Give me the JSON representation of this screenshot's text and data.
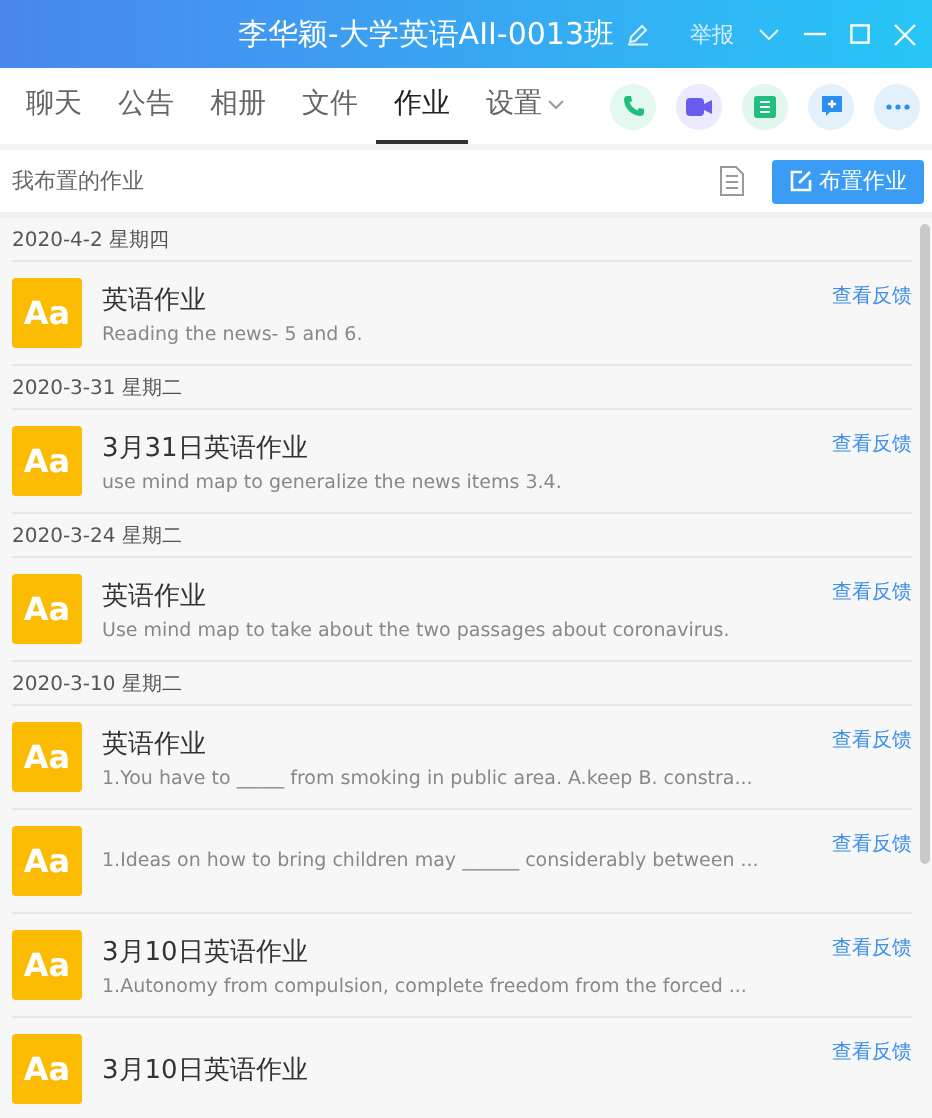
{
  "window": {
    "title": "李华颖-大学英语AII-0013班",
    "report": "举报"
  },
  "tabs": [
    {
      "label": "聊天",
      "selected": false,
      "kind": "plain"
    },
    {
      "label": "公告",
      "selected": false,
      "kind": "plain"
    },
    {
      "label": "相册",
      "selected": false,
      "kind": "plain"
    },
    {
      "label": "文件",
      "selected": false,
      "kind": "plain"
    },
    {
      "label": "作业",
      "selected": true,
      "kind": "plain"
    },
    {
      "label": "设置",
      "selected": false,
      "kind": "dropdown"
    }
  ],
  "toolbar": {
    "heading": "我布置的作业",
    "button": "布置作业"
  },
  "groups": [
    {
      "date": "2020-4-2 星期四",
      "items": [
        {
          "icon": "Aa",
          "title": "英语作业",
          "description": "Reading the news- 5 and 6.",
          "link": "查看反馈"
        }
      ]
    },
    {
      "date": "2020-3-31 星期二",
      "items": [
        {
          "icon": "Aa",
          "title": "3月31日英语作业",
          "description": "use mind map to generalize the news items 3.4.",
          "link": "查看反馈"
        }
      ]
    },
    {
      "date": "2020-3-24 星期二",
      "items": [
        {
          "icon": "Aa",
          "title": "英语作业",
          "description": "Use mind map to take about the two passages about coronavirus.",
          "link": "查看反馈"
        }
      ]
    },
    {
      "date": "2020-3-10 星期二",
      "items": [
        {
          "icon": "Aa",
          "title": "英语作业",
          "description": "1.You have to _____ from smoking in public area. A.keep B. constra...",
          "link": "查看反馈"
        },
        {
          "icon": "Aa",
          "description": "1.Ideas on how to bring children may ______ considerably between ...",
          "link": "查看反馈"
        },
        {
          "icon": "Aa",
          "title": "3月10日英语作业",
          "description": "1.Autonomy from compulsion, complete freedom from the forced ...",
          "link": "查看反馈"
        },
        {
          "icon": "Aa",
          "title": "3月10日英语作业",
          "link": "查看反馈"
        }
      ]
    }
  ]
}
